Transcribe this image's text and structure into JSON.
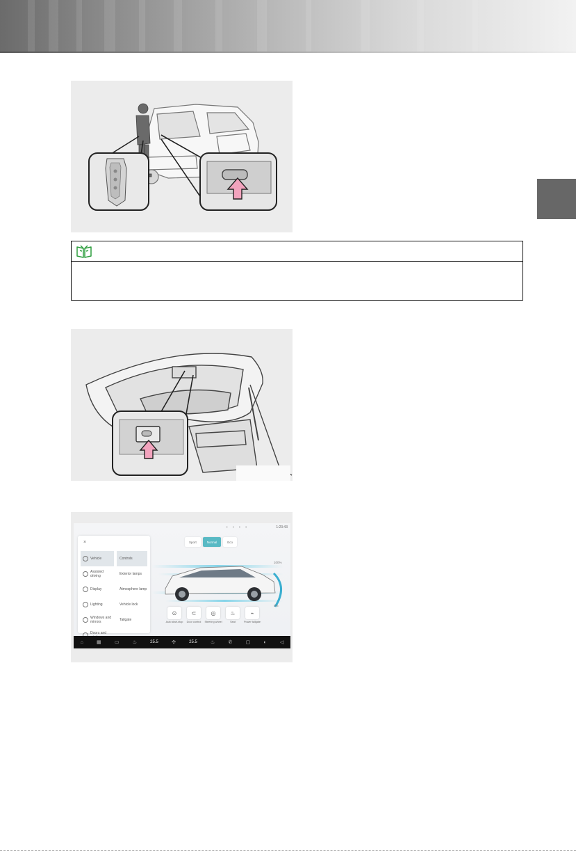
{
  "note": {
    "icon": "open-book-icon",
    "icon_color": "#2e9e3f"
  },
  "side_tab": {
    "color": "#676767"
  },
  "infotainment": {
    "clock": "1:23:43",
    "close_glyph": "×",
    "nav_items": [
      {
        "label": "Vehicle",
        "icon": "car-icon",
        "active": true
      },
      {
        "label": "Assisted driving",
        "icon": "steering-icon"
      },
      {
        "label": "Display",
        "icon": "display-icon"
      },
      {
        "label": "Lighting",
        "icon": "light-icon"
      },
      {
        "label": "Windows and mirrors",
        "icon": "window-icon"
      },
      {
        "label": "Doors and windows",
        "icon": "door-icon"
      }
    ],
    "sub_items": [
      {
        "label": "Controls",
        "active": true
      },
      {
        "label": "Exterior lamps"
      },
      {
        "label": "Atmosphere lamp"
      },
      {
        "label": "Vehicle lock"
      },
      {
        "label": "Tailgate"
      }
    ],
    "modes": [
      {
        "label": "Sport",
        "icon": "sport-mode-icon"
      },
      {
        "label": "Normal",
        "active": true
      },
      {
        "label": "Eco",
        "icon": "eco-mode-icon"
      }
    ],
    "range_top": "100%",
    "range_bottom": "0%",
    "shortcuts": [
      {
        "label": "Auto start-stop",
        "icon": "auto-hold-icon"
      },
      {
        "label": "Door control",
        "icon": "door-control-icon"
      },
      {
        "label": "Steering wheel",
        "icon": "steering-wheel-icon"
      },
      {
        "label": "Seat",
        "icon": "seat-icon"
      },
      {
        "label": "Power tailgate",
        "icon": "tailgate-icon"
      }
    ],
    "dock": {
      "temp_left": "25.5",
      "temp_right": "25.5"
    }
  }
}
